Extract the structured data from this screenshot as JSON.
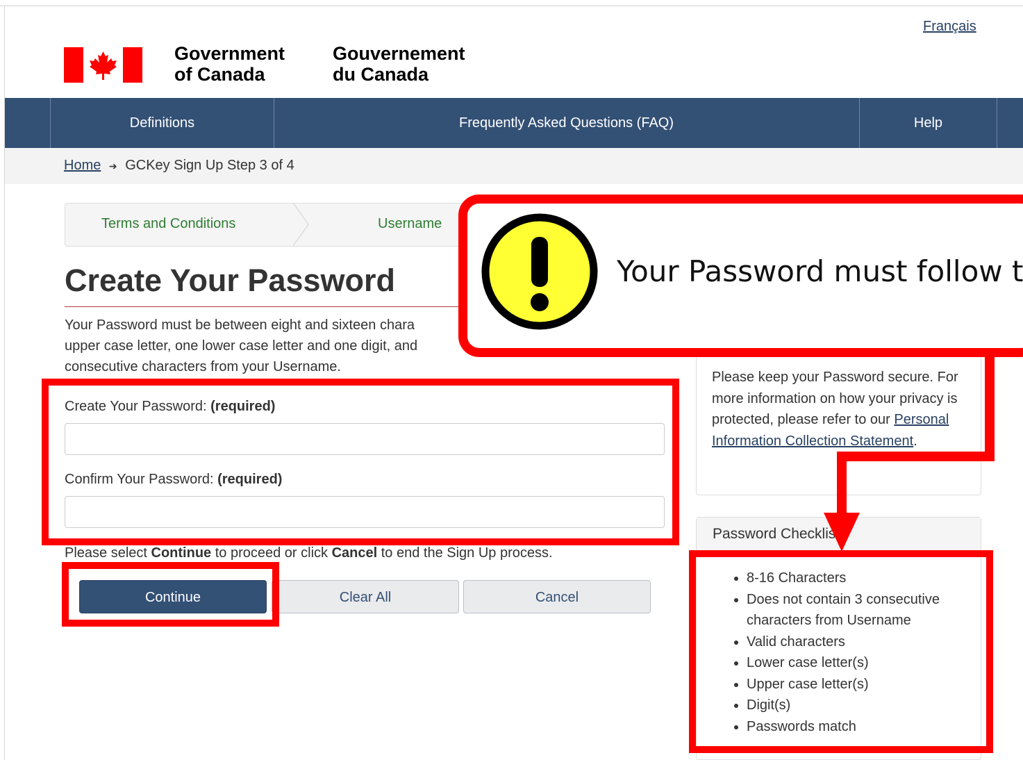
{
  "header": {
    "language_link": "Français",
    "gov_en_line1": "Government",
    "gov_en_line2": "of Canada",
    "gov_fr_line1": "Gouvernement",
    "gov_fr_line2": "du Canada"
  },
  "nav": {
    "items": [
      {
        "label": "Definitions"
      },
      {
        "label": "Frequently Asked Questions (FAQ)"
      },
      {
        "label": "Help"
      }
    ]
  },
  "breadcrumb": {
    "home": "Home",
    "arrow": "➔",
    "current": "GCKey Sign Up Step 3 of 4"
  },
  "steps": {
    "items": [
      "Terms and Conditions",
      "Username"
    ]
  },
  "main": {
    "title": "Create Your Password",
    "intro": "Your Password must be between eight and sixteen chara upper case letter, one lower case letter and one digit, and consecutive characters from your Username.",
    "intro_line1": "Your Password must be between eight and sixteen chara",
    "intro_line2": "upper case letter, one lower case letter and one digit, and",
    "intro_line3": "consecutive characters from your Username.",
    "password_label": "Create Your Password:",
    "confirm_label": "Confirm Your Password:",
    "required": "(required)",
    "instr_pre": "Please select ",
    "instr_continue": "Continue",
    "instr_mid": " to proceed or click ",
    "instr_cancel": "Cancel",
    "instr_post": " to end the Sign Up process."
  },
  "buttons": {
    "continue": "Continue",
    "clear_all": "Clear All",
    "cancel": "Cancel"
  },
  "privacy_panel": {
    "text": "Please keep your Password secure. For more information on how your privacy is protected, please refer to our",
    "link": "Personal Information Collection Statement",
    "end": "."
  },
  "checklist": {
    "title": "Password Checklist",
    "items": [
      "8-16 Characters",
      "Does not contain 3 consecutive characters from Username",
      "Valid characters",
      "Lower case letter(s)",
      "Upper case letter(s)",
      "Digit(s)",
      "Passwords match"
    ]
  },
  "callout": {
    "text": "Your Password must follow th",
    "icon": "warning-exclamation-icon"
  },
  "colors": {
    "nav_bg": "#335075",
    "annotation_red": "#ff0000",
    "warning_yellow": "#ffff33",
    "link": "#284162"
  }
}
